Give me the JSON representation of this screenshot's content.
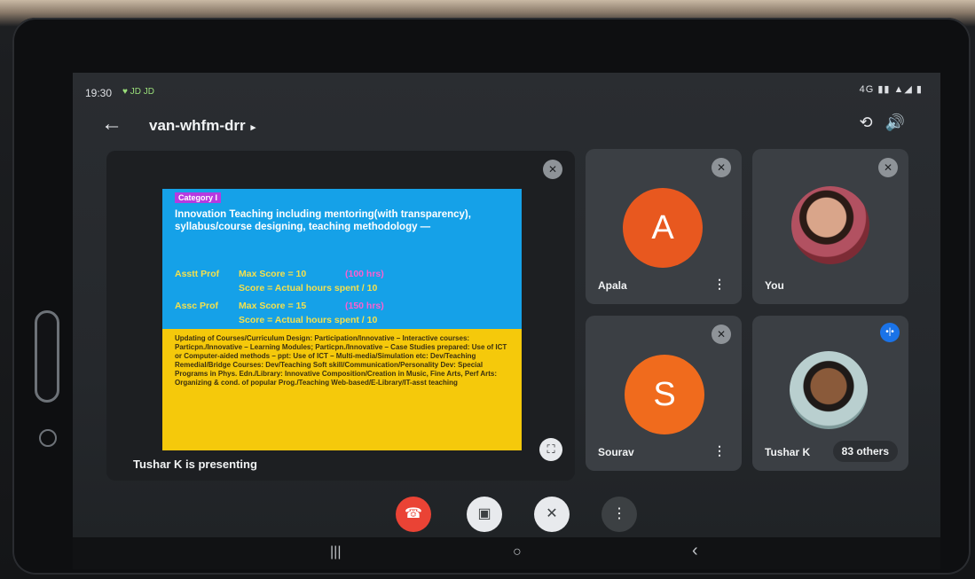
{
  "status": {
    "time": "19:30",
    "left_icons": "♥ JD JD",
    "right_icons": "4G ▮▮ ▲◢ ▮"
  },
  "header": {
    "meeting_code": "van-whfm-drr",
    "chevron": "▸"
  },
  "presentation": {
    "slide": {
      "category": "Category I",
      "heading": "Innovation Teaching including mentoring(with transparency), syllabus/course designing, teaching methodology —",
      "rows": [
        {
          "role": "Asstt Prof",
          "max": "Max Score = 10",
          "note": "(100 hrs)",
          "formula": "Score = Actual hours spent / 10"
        },
        {
          "role": "Assc Prof",
          "max": "Max Score = 15",
          "note": "(150 hrs)",
          "formula": "Score = Actual hours spent / 10"
        }
      ],
      "body": "Updating of Courses/Curriculum Design: Participation/Innovative – Interactive courses: Particpn./Innovative – Learning Modules; Particpn./Innovative – Case Studies prepared: Use of ICT or Computer-aided methods – ppt: Use of ICT – Multi-media/Simulation etc: Dev/Teaching Remedial/Bridge Courses: Dev/Teaching Soft skill/Communication/Personality Dev: Special Programs in Phys. Edn./Library: Innovative Composition/Creation in Music, Fine Arts, Perf Arts: Organizing & cond. of popular Prog./Teaching Web-based/E-Library/IT-asst teaching"
    },
    "presenting_label": "Tushar K is presenting"
  },
  "participants": [
    {
      "name": "Apala",
      "initial": "A",
      "color": "#e8581f"
    },
    {
      "name": "You"
    },
    {
      "name": "Sourav",
      "initial": "S",
      "color": "#f06b1d"
    },
    {
      "name": "Tushar K",
      "others": "83 others"
    }
  ],
  "icons": {
    "back": "←",
    "camera_switch": "⟲",
    "speaker": "🔊",
    "mic_off": "✕",
    "fullscreen": "⛶",
    "more": "⋮",
    "end_call": "☎",
    "camera_off": "▣",
    "more_controls": "⋮",
    "nav_recents": "|||",
    "nav_home": "○",
    "nav_back": "‹",
    "speaking": "•|•"
  },
  "colors": {
    "end_call": "#ea4335",
    "accent": "#1a73e8"
  }
}
